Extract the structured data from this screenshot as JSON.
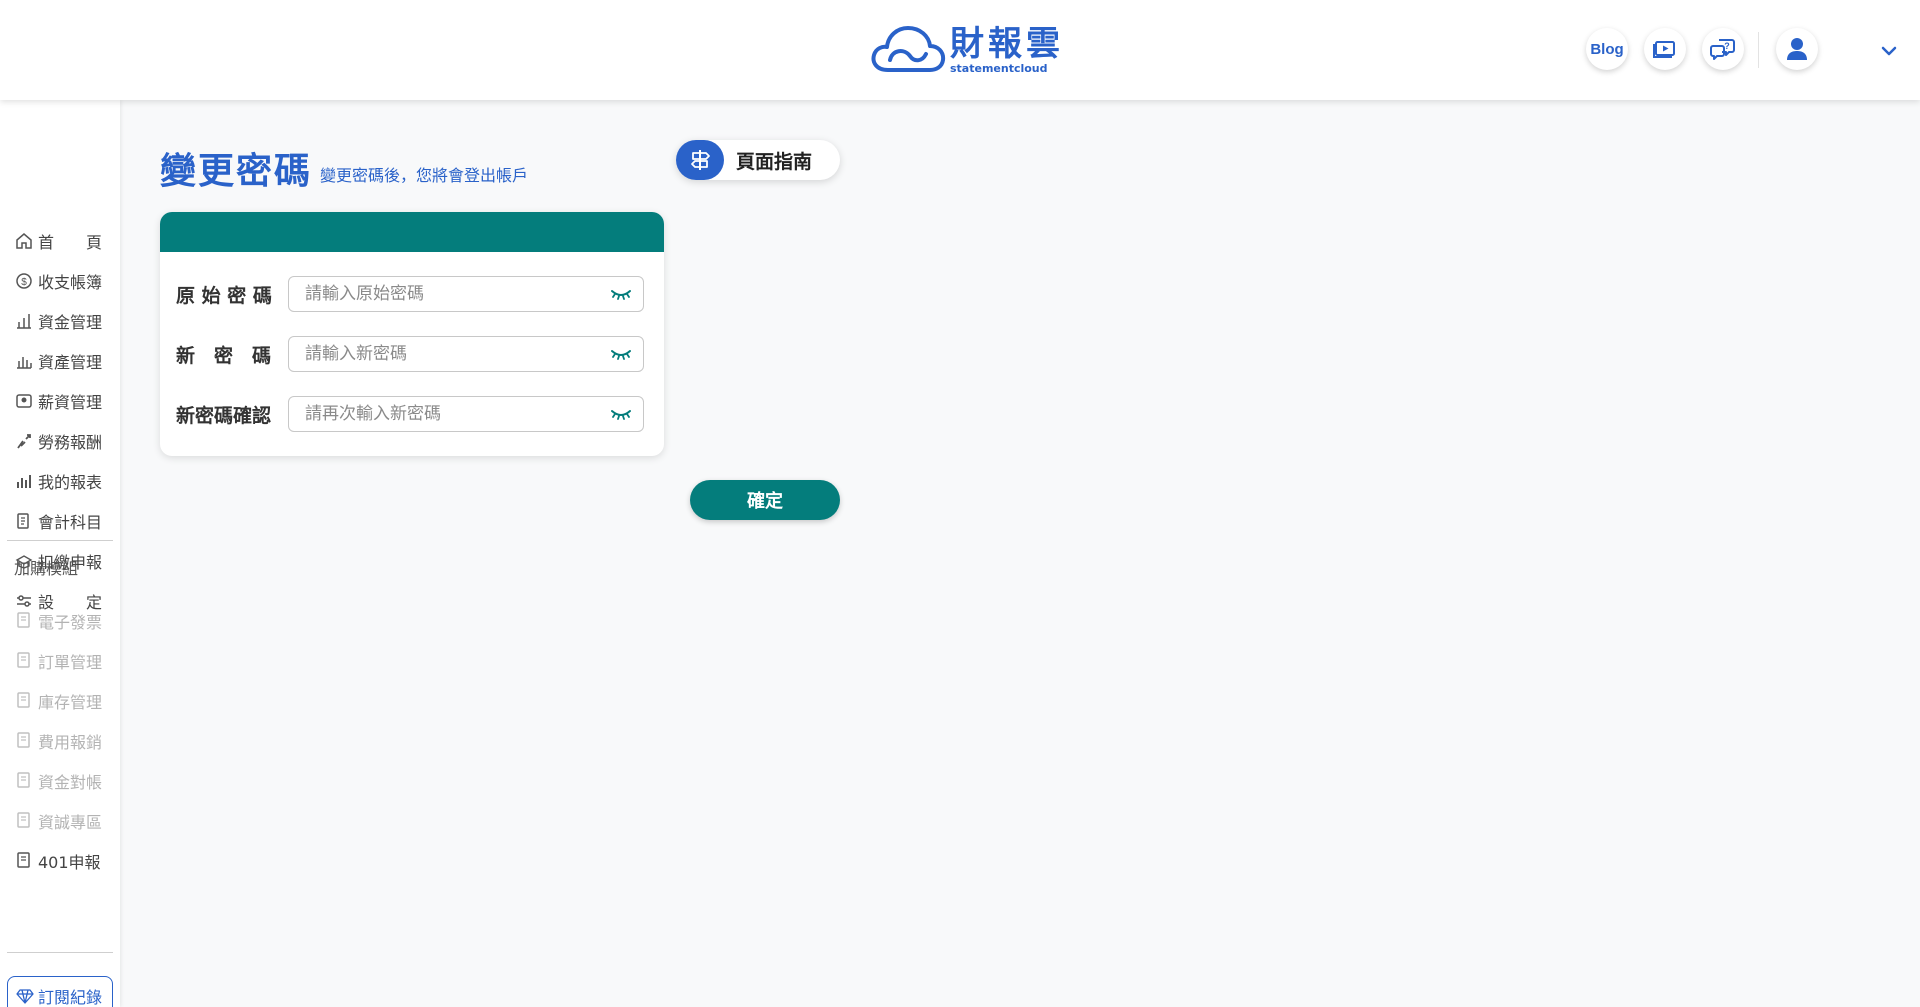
{
  "header": {
    "logo_main": "財報雲",
    "logo_sub": "statementcloud",
    "blog_label": "Blog",
    "icons": [
      "video-tutorial-icon",
      "help-chat-icon",
      "user-avatar-icon",
      "chevron-down-icon"
    ]
  },
  "sidebar": {
    "items": [
      {
        "label": "首　　頁",
        "icon": "home-icon"
      },
      {
        "label": "收支帳簿",
        "icon": "ledger-icon"
      },
      {
        "label": "資金管理",
        "icon": "funds-icon"
      },
      {
        "label": "資產管理",
        "icon": "assets-icon"
      },
      {
        "label": "薪資管理",
        "icon": "salary-icon"
      },
      {
        "label": "勞務報酬",
        "icon": "labor-icon"
      },
      {
        "label": "我的報表",
        "icon": "report-icon"
      },
      {
        "label": "會計科目",
        "icon": "accounts-icon"
      },
      {
        "label": "扣繳申報",
        "icon": "withholding-icon"
      },
      {
        "label": "設　　定",
        "icon": "settings-icon"
      }
    ],
    "addon_section": "加購模組",
    "addons": [
      {
        "label": "電子發票",
        "enabled": false
      },
      {
        "label": "訂單管理",
        "enabled": false
      },
      {
        "label": "庫存管理",
        "enabled": false
      },
      {
        "label": "費用報銷",
        "enabled": false
      },
      {
        "label": "資金對帳",
        "enabled": false
      },
      {
        "label": "資誠專區",
        "enabled": false
      },
      {
        "label": "401申報",
        "enabled": true
      }
    ],
    "subscription_label": "訂閱紀錄"
  },
  "main": {
    "title": "變更密碼",
    "subtitle": "變更密碼後，您將會登出帳戶",
    "guide_label": "頁面指南",
    "fields": [
      {
        "label": "原 始 密 碼",
        "placeholder": "請輸入原始密碼",
        "value": ""
      },
      {
        "label": "新　密　碼",
        "placeholder": "請輸入新密碼",
        "value": ""
      },
      {
        "label": "新密碼確認",
        "placeholder": "請再次輸入新密碼",
        "value": ""
      }
    ],
    "confirm_label": "確定"
  },
  "colors": {
    "brand_blue": "#2a62c9",
    "teal": "#047d7c"
  }
}
